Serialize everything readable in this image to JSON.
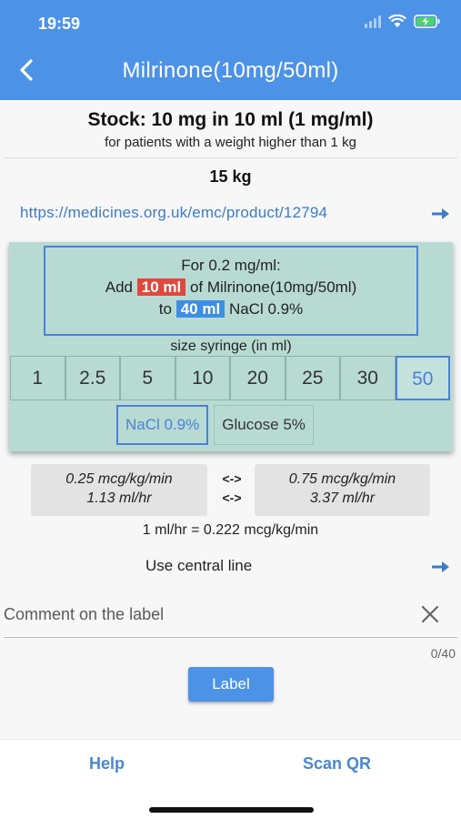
{
  "status_bar": {
    "time": "19:59"
  },
  "header": {
    "title": "Milrinone(10mg/50ml)"
  },
  "stock": {
    "title": "Stock: 10 mg in 10 ml (1 mg/ml)",
    "subtitle": "for patients with a weight higher than 1 kg"
  },
  "patient": {
    "weight": "15 kg"
  },
  "reference": {
    "url": "https://medicines.org.uk/emc/product/12794"
  },
  "recipe": {
    "line1": "For 0.2 mg/ml:",
    "add_prefix": "Add",
    "drug_volume": "10 ml",
    "add_suffix": "of Milrinone(10mg/50ml)",
    "to_prefix": "to",
    "diluent_volume": "40 ml",
    "diluent_name": "NaCl 0.9%"
  },
  "syringe": {
    "label": "size syringe (in ml)",
    "sizes": [
      "1",
      "2.5",
      "5",
      "10",
      "20",
      "25",
      "30",
      "50"
    ],
    "selected": "50"
  },
  "fluids": {
    "options": [
      "NaCl 0.9%",
      "Glucose 5%"
    ],
    "selected": "NaCl 0.9%"
  },
  "dose_range": {
    "min_dose": "0.25 mcg/kg/min",
    "min_rate": "1.13 ml/hr",
    "max_dose": "0.75 mcg/kg/min",
    "max_rate": "3.37 ml/hr",
    "swap_symbol": "<->"
  },
  "conversion": "1 ml/hr = 0.222 mcg/kg/min",
  "instructions": "Use central line",
  "comment": {
    "placeholder": "Comment on the label",
    "value": "",
    "counter": "0/40"
  },
  "actions": {
    "label_button": "Label"
  },
  "bottom_nav": {
    "help": "Help",
    "scan_qr": "Scan QR"
  },
  "colors": {
    "primary": "#4c92e6",
    "panel": "#b7dbd3",
    "highlight_red": "#e0483d",
    "highlight_blue": "#3e8ee3"
  }
}
